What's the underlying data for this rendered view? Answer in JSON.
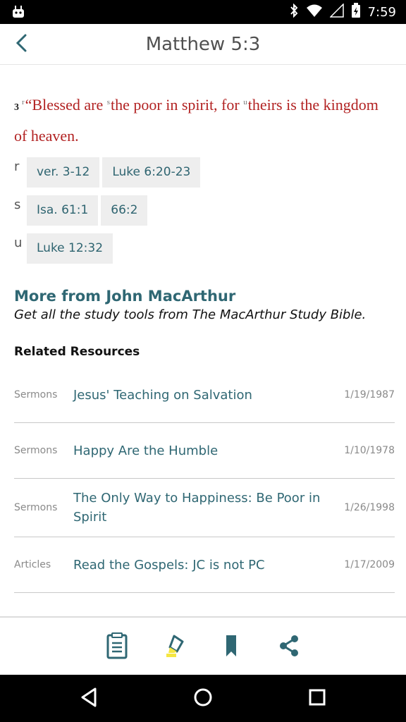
{
  "status_bar": {
    "time": "7:59"
  },
  "header": {
    "title": "Matthew 5:3"
  },
  "verse": {
    "number": "3",
    "marker_r": "r",
    "part1": "“Blessed are ",
    "marker_s": "s",
    "part2": "the poor in spirit, for ",
    "marker_u": "u",
    "part3": "theirs is the kingdom of heaven."
  },
  "cross_refs": [
    {
      "letter": "r",
      "refs": [
        "ver. 3-12",
        "Luke 6:20-23"
      ]
    },
    {
      "letter": "s",
      "refs": [
        "Isa. 61:1",
        "66:2"
      ]
    },
    {
      "letter": "u",
      "refs": [
        "Luke 12:32"
      ]
    }
  ],
  "more": {
    "title": "More from John MacArthur",
    "subtitle": "Get all the study tools from The MacArthur Study Bible."
  },
  "related": {
    "title": "Related Resources",
    "items": [
      {
        "type": "Sermons",
        "title": "Jesus' Teaching on Salvation",
        "date": "1/19/1987"
      },
      {
        "type": "Sermons",
        "title": "Happy Are the Humble",
        "date": "1/10/1978"
      },
      {
        "type": "Sermons",
        "title": "The Only Way to Happiness: Be Poor in Spirit",
        "date": "1/26/1998"
      },
      {
        "type": "Articles",
        "title": "Read the Gospels: JC is not PC",
        "date": "1/17/2009"
      }
    ]
  },
  "toolbar": {
    "icons": [
      "notes-icon",
      "highlighter-icon",
      "bookmark-icon",
      "share-icon"
    ],
    "accent": "#2f6773",
    "highlight": "#f5e642"
  },
  "colors": {
    "verse_red": "#b22222",
    "link_teal": "#2f6773"
  }
}
